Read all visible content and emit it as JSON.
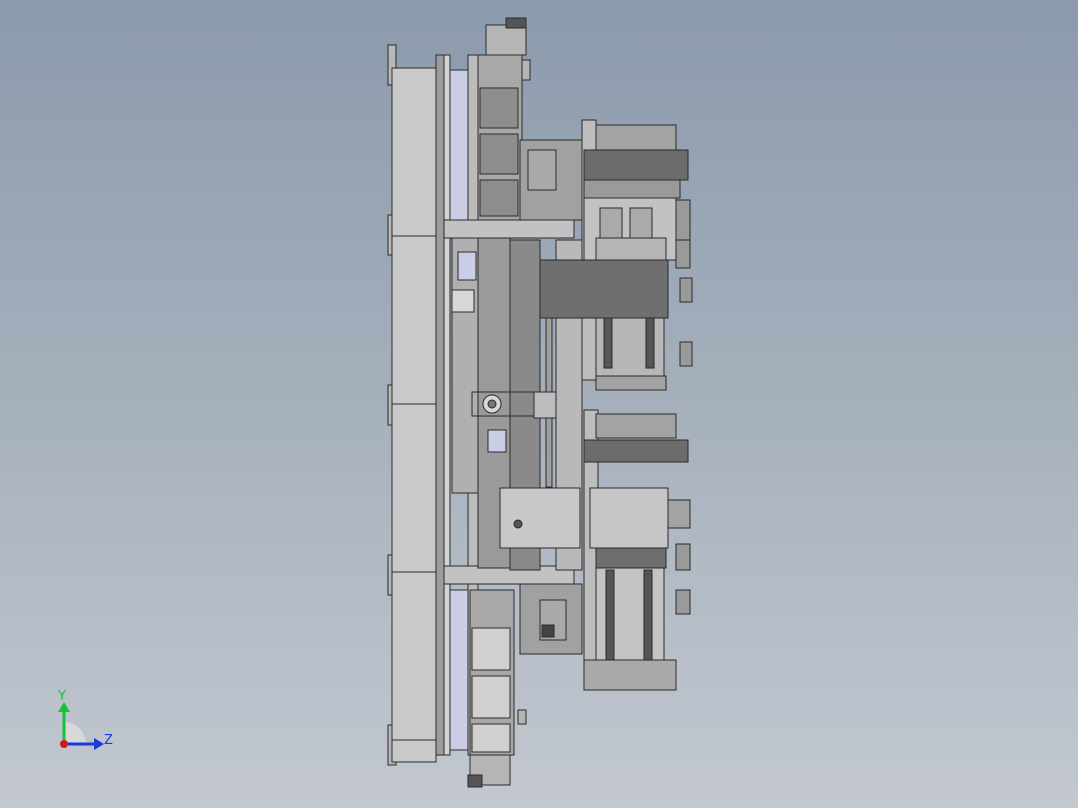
{
  "triad": {
    "y_label": "Y",
    "z_label": "Z",
    "y_color": "#16c23a",
    "z_color": "#1a3ad6",
    "x_color": "#d01818"
  },
  "colors": {
    "plate_light": "#c7c7c7",
    "plate_mid": "#a9a9a9",
    "plate_dark": "#6c6c6c",
    "guide_blue": "#c9cde6",
    "outline": "#2a2a2a"
  }
}
